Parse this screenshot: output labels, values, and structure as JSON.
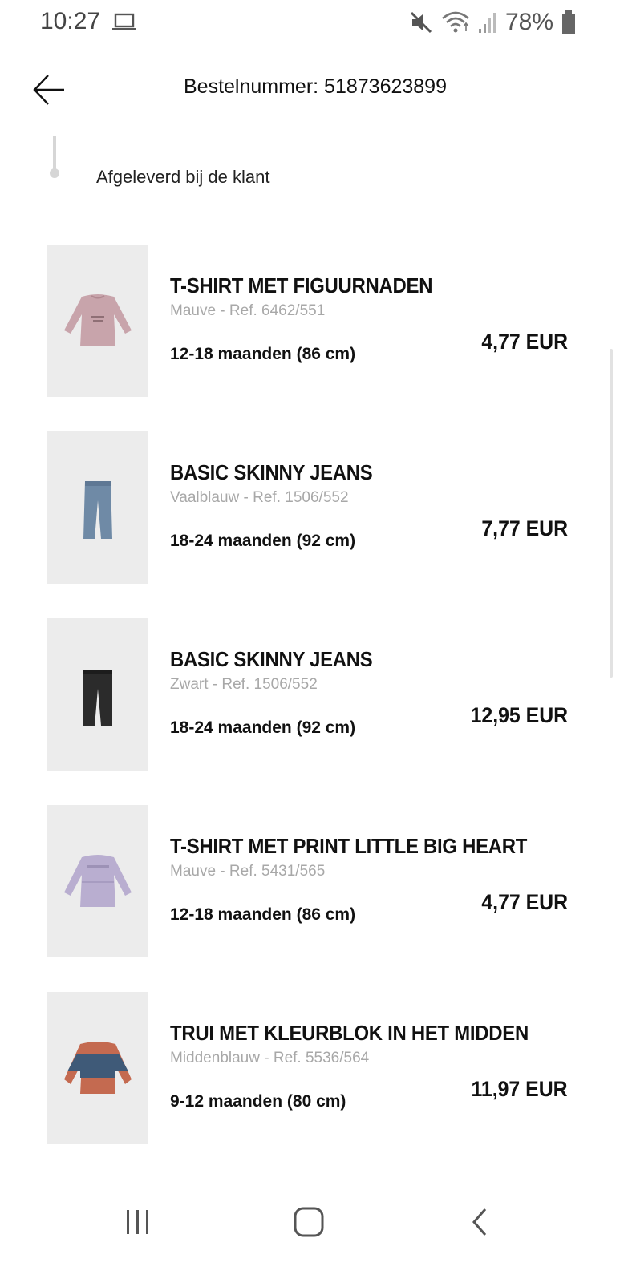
{
  "status_bar": {
    "time": "10:27",
    "battery": "78%",
    "icons": [
      "laptop-icon",
      "mute-icon",
      "wifi-icon",
      "signal-icon",
      "battery-icon"
    ]
  },
  "header": {
    "title": "Bestelnummer: 51873623899",
    "back_icon": "arrow-left-icon"
  },
  "order_status": {
    "label": "Afgeleverd bij de klant"
  },
  "products": [
    {
      "name": "T-SHIRT MET FIGUURNADEN",
      "ref": "Mauve - Ref. 6462/551",
      "size": "12-18 maanden (86 cm)",
      "price": "4,77 EUR",
      "image": "mauve-longsleeve-tshirt",
      "color": "#c8a4ab"
    },
    {
      "name": "BASIC SKINNY JEANS",
      "ref": "Vaalblauw - Ref. 1506/552",
      "size": "18-24 maanden (92 cm)",
      "price": "7,77 EUR",
      "image": "light-blue-jeans",
      "color": "#6f8aa6"
    },
    {
      "name": "BASIC SKINNY JEANS",
      "ref": "Zwart - Ref. 1506/552",
      "size": "18-24 maanden (92 cm)",
      "price": "12,95 EUR",
      "image": "black-jeans",
      "color": "#2b2b2b"
    },
    {
      "name": "T-SHIRT MET PRINT LITTLE BIG HEART",
      "ref": "Mauve - Ref. 5431/565",
      "size": "12-18 maanden (86 cm)",
      "price": "4,77 EUR",
      "image": "lilac-longsleeve-tshirt",
      "color": "#b9aed0"
    },
    {
      "name": "TRUI MET KLEURBLOK IN HET MIDDEN",
      "ref": "Middenblauw - Ref. 5536/564",
      "size": "9-12 maanden (80 cm)",
      "price": "11,97 EUR",
      "image": "colorblock-sweater",
      "color": "#3f5a78"
    }
  ],
  "nav_bar": {
    "buttons": [
      "recents-icon",
      "home-icon",
      "back-icon"
    ]
  }
}
